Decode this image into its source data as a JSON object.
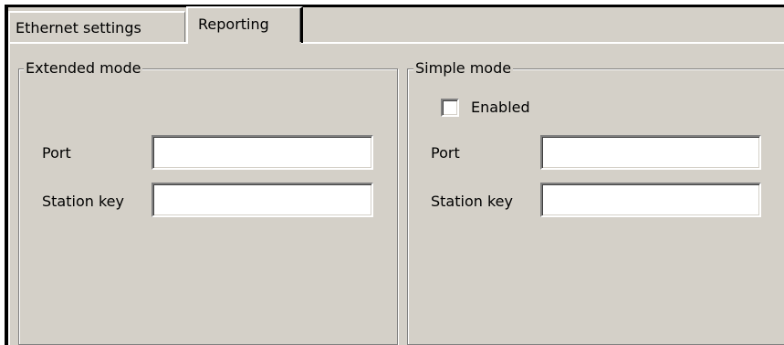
{
  "tabs": [
    {
      "label": "Ethernet settings",
      "selected": false
    },
    {
      "label": "Reporting",
      "selected": true
    }
  ],
  "extended_mode": {
    "title": "Extended mode",
    "port_label": "Port",
    "port_value": "",
    "station_key_label": "Station key",
    "station_key_value": ""
  },
  "simple_mode": {
    "title": "Simple mode",
    "enabled_label": "Enabled",
    "enabled_checked": false,
    "port_label": "Port",
    "port_value": "",
    "station_key_label": "Station key",
    "station_key_value": ""
  },
  "colors": {
    "face": "#d4d0c8",
    "shadow": "#808080",
    "highlight": "#ffffff"
  }
}
